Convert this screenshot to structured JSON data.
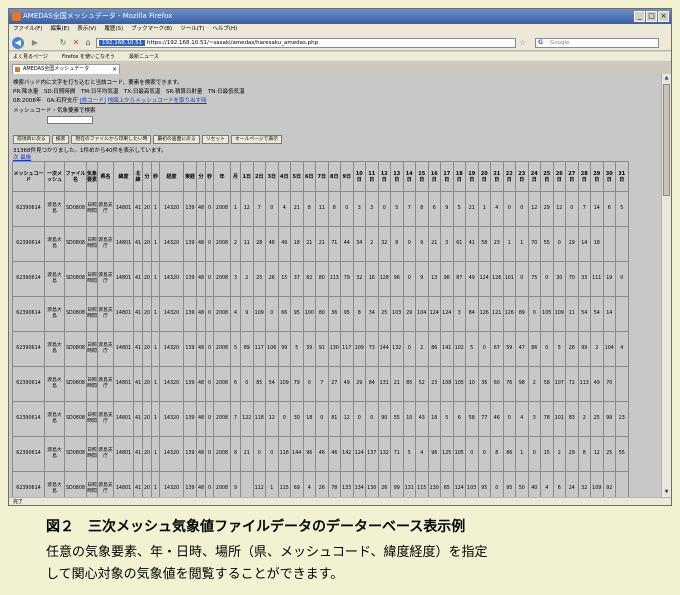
{
  "window": {
    "title": "AMEDAS全国メッシュデータ - Mozilla Firefox"
  },
  "menu": [
    "ファイル(F)",
    "編集(E)",
    "表示(V)",
    "履歴(S)",
    "ブックマーク(B)",
    "ツール(T)",
    "ヘルプ(H)"
  ],
  "nav": {
    "url_ip": "192.168.10.51",
    "url_rest": "https://192.168.10.51/~sasaki/amedas/haresaku_amedas.php",
    "search_placeholder": "Google"
  },
  "bookmarks": [
    "よく見るページ",
    "Firefox を使いこなそう",
    "最新ニュース"
  ],
  "tab": {
    "label": "AMEDAS全国メッシュデータ"
  },
  "page": {
    "instruction": "検索バッド内に文字を打ち込むと当該コード、要素を検索できます。",
    "legend": "PR:降水量　SD:日照時間　TM:日平均気温　TX:日最高気温　SR:積算日射量　TN:日最低気温",
    "location_prefix": "08:2008年　0A:石狩支庁",
    "link_prefix": "[県コード]",
    "link_text": "地図上からメッシュコードを取り出す時",
    "search_label": "メッシュコード・気象要素で検索",
    "buttons": [
      "前項目に戻る",
      "検索",
      "現在のファイルから印刷したい時",
      "最初の画面に戻る",
      "リセット",
      "オールページで表示"
    ],
    "result_text": "31368件見つかりました。1件めから40件を表示しています。",
    "next_link": "次 最後"
  },
  "table": {
    "headers": [
      "メッシュコード",
      "一次メッシュ",
      "ファイル名",
      "気象要素",
      "県名",
      "緯度",
      "北緯",
      "分",
      "秒",
      "経度",
      "東経",
      "分",
      "秒",
      "年",
      "月",
      "1日",
      "2日",
      "3日",
      "4日",
      "5日",
      "6日",
      "7日",
      "8日",
      "9日",
      "10日",
      "11日",
      "12日",
      "13日",
      "14日",
      "15日",
      "16日",
      "17日",
      "18日",
      "19日",
      "20日",
      "21日",
      "22日",
      "23日",
      "24日",
      "25日",
      "26日",
      "27日",
      "28日",
      "29日",
      "30日",
      "31日"
    ],
    "rows": [
      [
        "62390614",
        "渡島大島",
        "SD0808",
        "日照時間",
        "渡島支庁",
        "14801",
        "41",
        "20",
        "1",
        "14320",
        "139",
        "48",
        "0",
        "2008",
        "1",
        "12",
        "7",
        "0",
        "4",
        "21",
        "8",
        "11",
        "8",
        "0",
        "3",
        "3",
        "0",
        "5",
        "7",
        "8",
        "6",
        "9",
        "5",
        "21",
        "1",
        "4",
        "0",
        "0",
        "12",
        "29",
        "12",
        "0",
        "7",
        "14",
        "6",
        "5"
      ],
      [
        "62390614",
        "渡島大島",
        "SD0808",
        "日照時間",
        "渡島支庁",
        "14801",
        "41",
        "20",
        "1",
        "14320",
        "139",
        "48",
        "0",
        "2008",
        "2",
        "11",
        "28",
        "48",
        "49",
        "18",
        "21",
        "21",
        "71",
        "44",
        "34",
        "2",
        "32",
        "8",
        "0",
        "9",
        "21",
        "3",
        "61",
        "41",
        "58",
        "23",
        "1",
        "1",
        "70",
        "55",
        "0",
        "29",
        "14",
        "18",
        "",
        ""
      ],
      [
        "62390614",
        "渡島大島",
        "SD0808",
        "日照時間",
        "渡島支庁",
        "14801",
        "41",
        "20",
        "1",
        "14320",
        "139",
        "48",
        "0",
        "2008",
        "3",
        "2",
        "25",
        "26",
        "15",
        "37",
        "82",
        "80",
        "113",
        "79",
        "32",
        "16",
        "128",
        "96",
        "0",
        "9",
        "13",
        "96",
        "87",
        "49",
        "124",
        "126",
        "101",
        "0",
        "75",
        "0",
        "30",
        "70",
        "33",
        "111",
        "19",
        "0"
      ],
      [
        "62390614",
        "渡島大島",
        "SD0808",
        "日照時間",
        "渡島支庁",
        "14801",
        "41",
        "20",
        "1",
        "14320",
        "139",
        "48",
        "0",
        "2008",
        "4",
        "9",
        "109",
        "0",
        "66",
        "95",
        "100",
        "80",
        "36",
        "95",
        "8",
        "34",
        "25",
        "103",
        "29",
        "104",
        "124",
        "124",
        "3",
        "84",
        "126",
        "121",
        "126",
        "89",
        "0",
        "105",
        "109",
        "11",
        "54",
        "54",
        "14",
        ""
      ],
      [
        "62390614",
        "渡島大島",
        "SD0808",
        "日照時間",
        "渡島支庁",
        "14801",
        "41",
        "20",
        "1",
        "14320",
        "139",
        "48",
        "0",
        "2008",
        "5",
        "89",
        "117",
        "106",
        "99",
        "5",
        "39",
        "91",
        "130",
        "117",
        "109",
        "73",
        "144",
        "132",
        "0",
        "2",
        "86",
        "141",
        "102",
        "5",
        "0",
        "67",
        "59",
        "47",
        "86",
        "0",
        "5",
        "26",
        "99",
        "2",
        "104",
        "4"
      ],
      [
        "62390614",
        "渡島大島",
        "SD0808",
        "日照時間",
        "渡島支庁",
        "14801",
        "41",
        "20",
        "1",
        "14320",
        "139",
        "48",
        "0",
        "2008",
        "6",
        "0",
        "85",
        "54",
        "109",
        "79",
        "0",
        "7",
        "27",
        "49",
        "29",
        "84",
        "131",
        "21",
        "85",
        "52",
        "23",
        "108",
        "105",
        "10",
        "36",
        "60",
        "76",
        "98",
        "2",
        "58",
        "107",
        "72",
        "113",
        "49",
        "70",
        ""
      ],
      [
        "62390614",
        "渡島大島",
        "SD0808",
        "日照時間",
        "渡島支庁",
        "14801",
        "41",
        "20",
        "1",
        "14320",
        "139",
        "48",
        "0",
        "2008",
        "7",
        "122",
        "118",
        "12",
        "0",
        "30",
        "18",
        "0",
        "81",
        "12",
        "0",
        "0",
        "90",
        "55",
        "10",
        "43",
        "18",
        "5",
        "6",
        "58",
        "77",
        "46",
        "0",
        "4",
        "3",
        "78",
        "101",
        "83",
        "2",
        "25",
        "99",
        "23"
      ],
      [
        "62390614",
        "渡島大島",
        "SD0808",
        "日照時間",
        "渡島支庁",
        "14801",
        "41",
        "20",
        "1",
        "14320",
        "139",
        "48",
        "0",
        "2008",
        "8",
        "21",
        "0",
        "0",
        "116",
        "144",
        "96",
        "46",
        "46",
        "142",
        "124",
        "137",
        "132",
        "71",
        "5",
        "4",
        "96",
        "125",
        "105",
        "0",
        "0",
        "8",
        "86",
        "1",
        "0",
        "15",
        "2",
        "29",
        "8",
        "12",
        "25",
        "55"
      ],
      [
        "62390614",
        "渡島大島",
        "SD0808",
        "日照時間",
        "渡島支庁",
        "14801",
        "41",
        "20",
        "1",
        "14320",
        "139",
        "48",
        "0",
        "2008",
        "9",
        "",
        "112",
        "1",
        "115",
        "69",
        "4",
        "26",
        "78",
        "133",
        "134",
        "130",
        "26",
        "99",
        "131",
        "115",
        "130",
        "65",
        "124",
        "103",
        "95",
        "0",
        "95",
        "50",
        "40",
        "4",
        "6",
        "24",
        "32",
        "109",
        "92",
        ""
      ]
    ]
  },
  "status": "完了",
  "caption": {
    "title": "図２　三次メッシュ気象値ファイルデータのデーターベース表示例",
    "line1": "任意の気象要素、年・日時、場所（県、メッシュコード、緯度経度）を指定",
    "line2": "して関心対象の気象値を閲覧することができます。"
  }
}
